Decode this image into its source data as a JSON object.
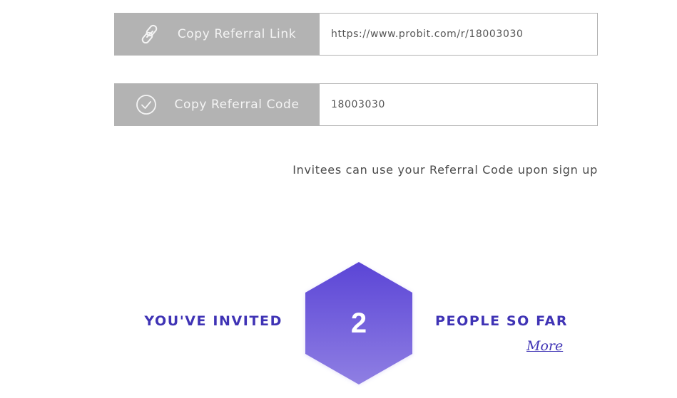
{
  "referral_link": {
    "button_label": "Copy Referral Link",
    "icon": "link-icon",
    "value": "https://www.probit.com/r/18003030"
  },
  "referral_code": {
    "button_label": "Copy Referral Code",
    "icon": "check-circle-icon",
    "value": "18003030"
  },
  "hint": "Invitees can use your Referral Code upon sign up",
  "invited": {
    "prefix": "YOU'VE INVITED",
    "count": "2",
    "suffix": "PEOPLE SO FAR",
    "more_label": "More"
  },
  "colors": {
    "button_bg": "#b3b3b3",
    "accent": "#3f33b5",
    "hex_top": "#5b45d6",
    "hex_bottom": "#8f7fe3"
  }
}
